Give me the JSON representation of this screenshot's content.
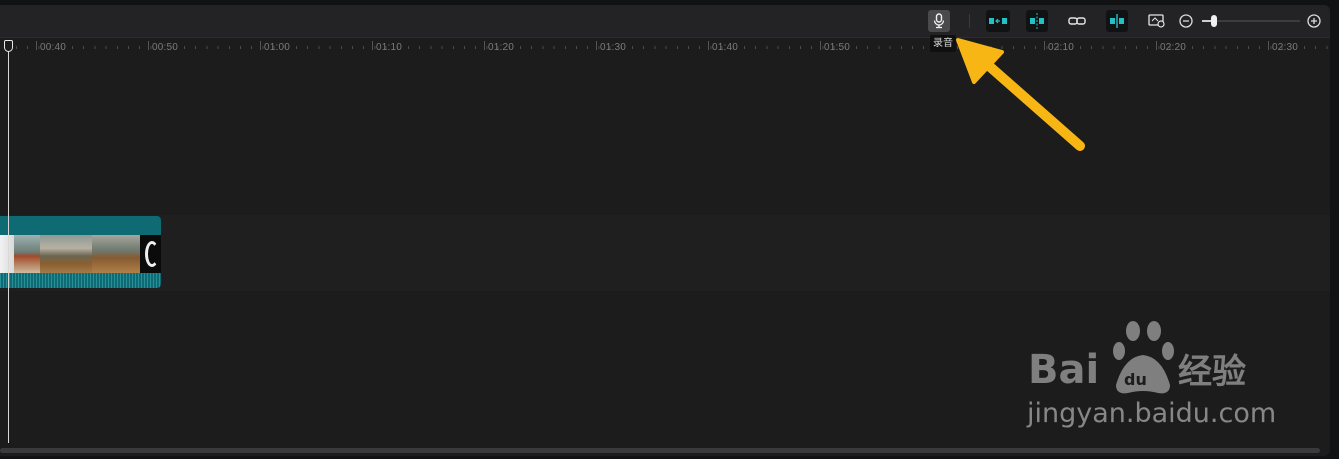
{
  "toolbar": {
    "icons": [
      "microphone-icon",
      "split-left-icon",
      "freeze-frame-icon",
      "link-icon",
      "split-icon",
      "preview-axis-icon",
      "zoom-out-icon",
      "zoom-in-icon"
    ],
    "tooltip": "录音",
    "accent_color": "#22c1c3",
    "zoom_level": 0.12
  },
  "ruler": {
    "labels": [
      "00:40",
      "00:50",
      "01:00",
      "01:10",
      "01:20",
      "01:30",
      "01:40",
      "01:50",
      "02:10",
      "02:20",
      "02:30"
    ]
  },
  "timeline": {
    "clip_color": "#0e6a73"
  },
  "annotation": {
    "arrow_color": "#f7b614"
  },
  "watermark": {
    "url_text": "jingyan.baidu.com"
  }
}
